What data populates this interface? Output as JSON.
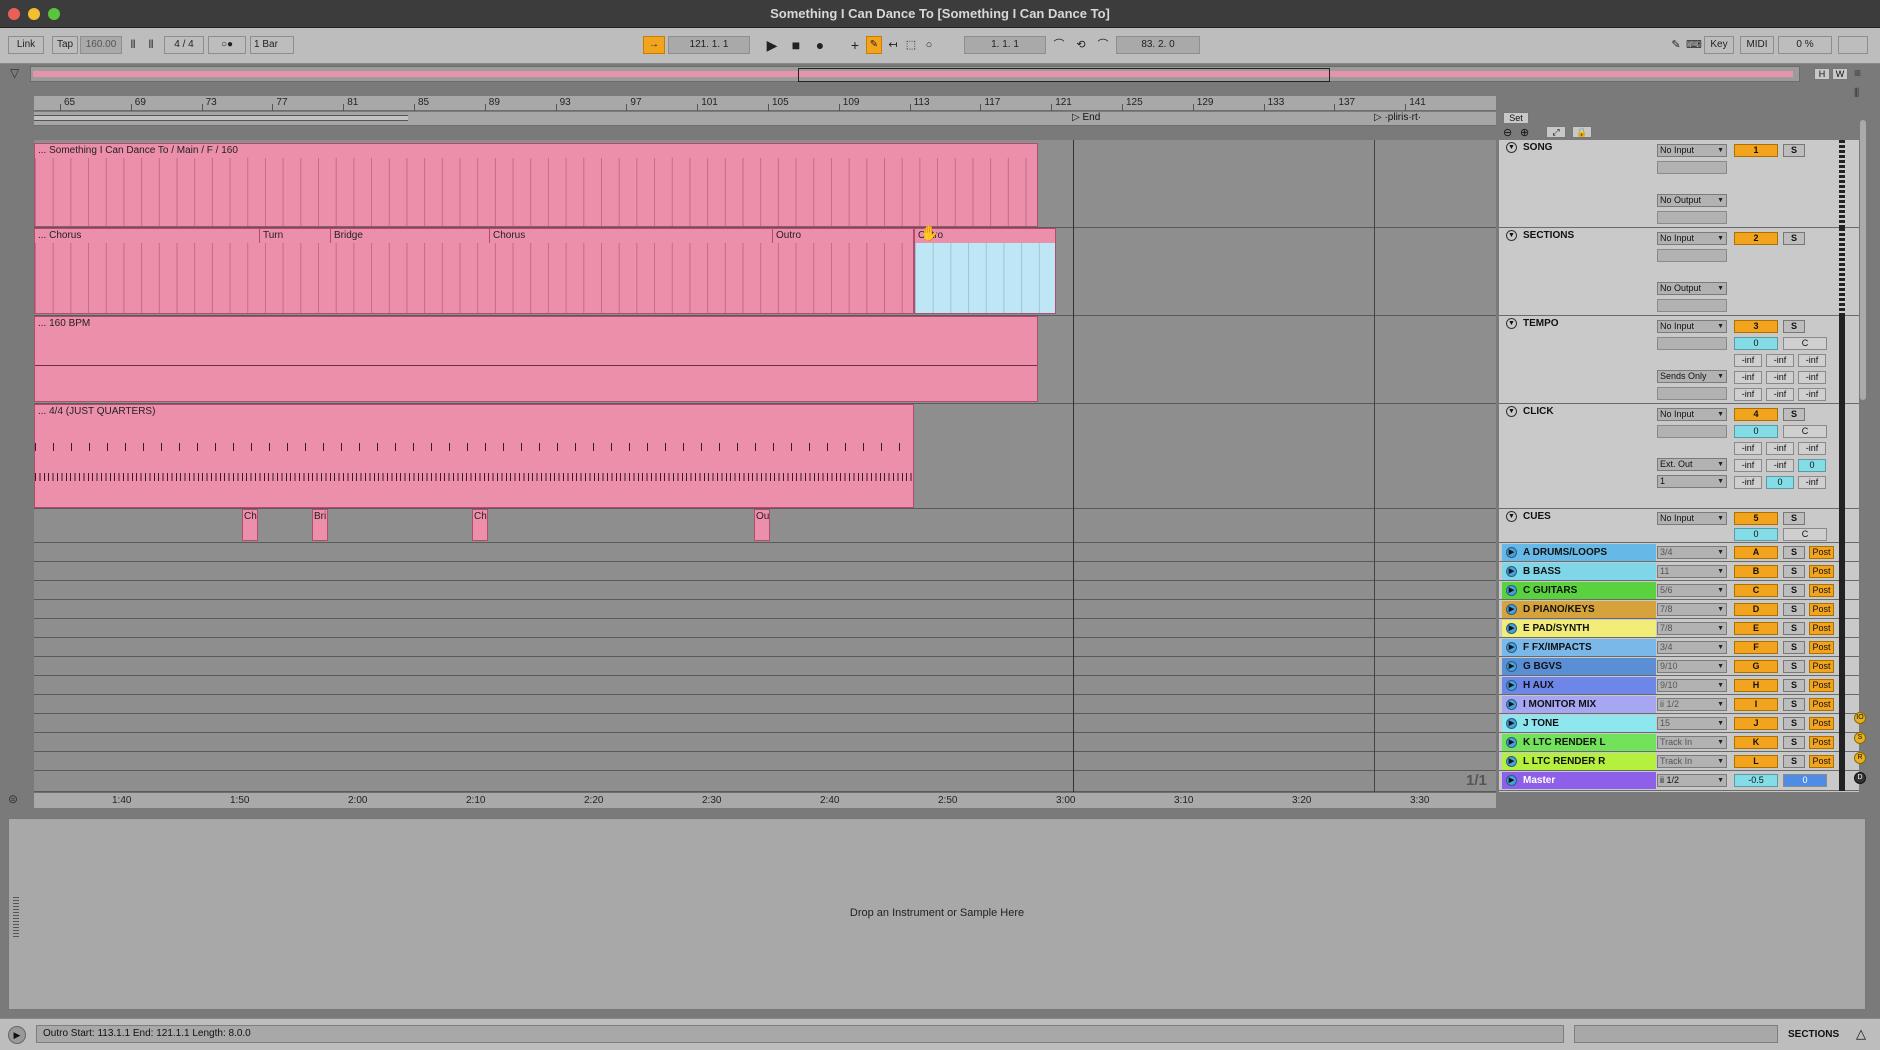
{
  "window": {
    "title": "Something I Can Dance To  [Something I Can Dance To]",
    "traffic_colors": {
      "close": "#ec5f57",
      "minimize": "#f3be2f",
      "zoom": "#5ac43d"
    }
  },
  "control_bar": {
    "link": "Link",
    "tap": "Tap",
    "tempo": "160.00",
    "signature": "4 / 4",
    "metro_icon": "○●",
    "quantize": "1 Bar",
    "position": "121.   1.   1",
    "play_icon": "play-icon",
    "stop_icon": "stop-icon",
    "record_icon": "record-icon",
    "loop_start": "1.   1.   1",
    "loop_length": "83.   2.   0",
    "key": "Key",
    "midi": "MIDI",
    "cpu": "0 %"
  },
  "overview": {
    "h_button": "H",
    "w_button": "W"
  },
  "ruler": {
    "bars": [
      "65",
      "69",
      "73",
      "77",
      "81",
      "85",
      "89",
      "93",
      "97",
      "101",
      "105",
      "109",
      "113",
      "117",
      "121",
      "125",
      "129",
      "133",
      "137",
      "141"
    ],
    "locators": {
      "end": "End",
      "spliris": "·pliris·rt·"
    },
    "times": [
      "1:40",
      "1:50",
      "2:00",
      "2:10",
      "2:20",
      "2:30",
      "2:40",
      "2:50",
      "3:00",
      "3:10",
      "3:20",
      "3:30"
    ]
  },
  "clips": {
    "song": "... Something I Can Dance To / Main / F / 160",
    "sections": [
      {
        "label": "... Chorus"
      },
      {
        "label": "Turn"
      },
      {
        "label": "Bridge"
      },
      {
        "label": "Chorus"
      },
      {
        "label": "Outro"
      },
      {
        "label": "Outro"
      }
    ],
    "tempo": "... 160 BPM",
    "click": "... 4/4 (JUST QUARTERS)",
    "cues": [
      "Ch",
      "Bri",
      "Ch",
      "Ou"
    ]
  },
  "set_button": "Set",
  "tracks": [
    {
      "name": "SONG",
      "input": "No Input",
      "output": "No Output",
      "number": "1",
      "solo": "S"
    },
    {
      "name": "SECTIONS",
      "input": "No Input",
      "output": "No Output",
      "number": "2",
      "solo": "S"
    },
    {
      "name": "TEMPO",
      "input": "No Input",
      "output": "Sends Only",
      "number": "3",
      "solo": "S",
      "vol": "0",
      "pan": "C",
      "vals": [
        "-inf",
        "-inf",
        "-inf",
        "-inf",
        "-inf",
        "-inf",
        "-inf",
        "-inf",
        "-inf"
      ]
    },
    {
      "name": "CLICK",
      "input": "No Input",
      "output": "Ext. Out",
      "channel": "1",
      "number": "4",
      "solo": "S",
      "vol": "0",
      "pan": "C",
      "vals": [
        "-inf",
        "-inf",
        "-inf",
        "-inf",
        "-inf",
        "0",
        "-inf",
        "0",
        "-inf"
      ]
    },
    {
      "name": "CUES",
      "input": "No Input",
      "number": "5",
      "solo": "S",
      "vol": "0",
      "pan": "C"
    }
  ],
  "groups": [
    {
      "name": "A DRUMS/LOOPS",
      "route": "3/4",
      "letter": "A",
      "solo": "S",
      "post": "Post",
      "color": "#66b8e6"
    },
    {
      "name": "B BASS",
      "route": "11",
      "letter": "B",
      "solo": "S",
      "post": "Post",
      "color": "#7fd6e8"
    },
    {
      "name": "C GUITARS",
      "route": "5/6",
      "letter": "C",
      "solo": "S",
      "post": "Post",
      "color": "#5ad23f"
    },
    {
      "name": "D PIANO/KEYS",
      "route": "7/8",
      "letter": "D",
      "solo": "S",
      "post": "Post",
      "color": "#d6a23b"
    },
    {
      "name": "E PAD/SYNTH",
      "route": "7/8",
      "letter": "E",
      "solo": "S",
      "post": "Post",
      "color": "#f2ec78"
    },
    {
      "name": "F FX/IMPACTS",
      "route": "3/4",
      "letter": "F",
      "solo": "S",
      "post": "Post",
      "color": "#7ab8ea"
    },
    {
      "name": "G BGVS",
      "route": "9/10",
      "letter": "G",
      "solo": "S",
      "post": "Post",
      "color": "#5a8fd6"
    },
    {
      "name": "H AUX",
      "route": "9/10",
      "letter": "H",
      "solo": "S",
      "post": "Post",
      "color": "#6e86e8"
    },
    {
      "name": "I MONITOR MIX",
      "route": "ii 1/2",
      "letter": "I",
      "solo": "S",
      "post": "Post",
      "color": "#a6a6f2"
    },
    {
      "name": "J TONE",
      "route": "15",
      "letter": "J",
      "solo": "S",
      "post": "Post",
      "color": "#8ee6ef"
    },
    {
      "name": "K LTC RENDER L",
      "route": "Track In",
      "letter": "K",
      "solo": "S",
      "post": "Post",
      "color": "#72e25b"
    },
    {
      "name": "L LTC RENDER R",
      "route": "Track In",
      "letter": "L",
      "solo": "S",
      "post": "Post",
      "color": "#b6f03e"
    }
  ],
  "master": {
    "name": "Master",
    "route": "ii 1/2",
    "vol": "-0.5",
    "pan": "0",
    "color": "#8e5fe8"
  },
  "page_indicator": "1/1",
  "detail": {
    "drop_text": "Drop an Instrument or Sample Here"
  },
  "status": {
    "text": "Outro Start: 113.1.1  End: 121.1.1  Length: 8.0.0",
    "view_label": "SECTIONS"
  }
}
